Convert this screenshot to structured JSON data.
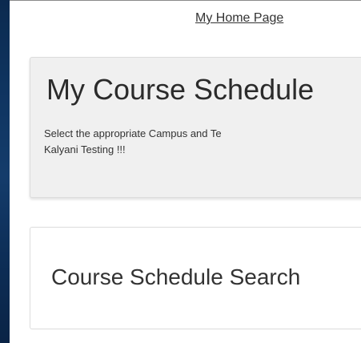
{
  "header": {
    "home_link_label": "My Home Page"
  },
  "schedule_card": {
    "title": "My Course Schedule",
    "instruction_line1": "Select the appropriate Campus and Te",
    "instruction_line2": "Kalyani Testing !!!"
  },
  "search_card": {
    "title": "Course Schedule Search"
  },
  "colors": {
    "left_rail": "#0f3460",
    "header_card_bg": "#f0f0f0",
    "text": "#333333"
  }
}
